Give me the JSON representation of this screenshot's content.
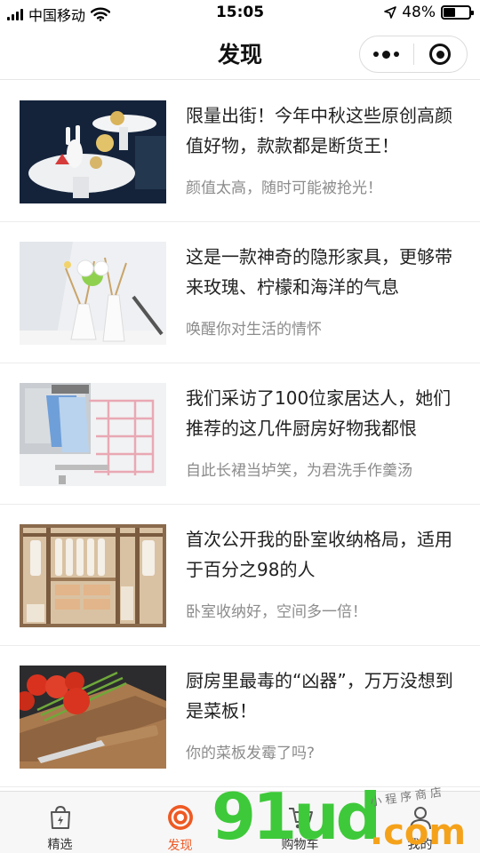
{
  "status_bar": {
    "carrier": "中国移动",
    "time": "15:05",
    "battery_text": "48%",
    "battery_level": 0.48
  },
  "nav": {
    "title": "发现"
  },
  "articles": [
    {
      "title": "限量出街！今年中秋这些原创高颜值好物，款款都是断货王！",
      "subtitle": "颜值太高，随时可能被抢光！"
    },
    {
      "title": "这是一款神奇的隐形家具，更够带来玫瑰、柠檬和海洋的气息",
      "subtitle": "唤醒你对生活的情怀"
    },
    {
      "title": "我们采访了100位家居达人，她们推荐的这几件厨房好物我都恨",
      "subtitle": "自此长裙当垆笑，为君洗手作羹汤"
    },
    {
      "title": "首次公开我的卧室收纳格局，适用于百分之98的人",
      "subtitle": "卧室收纳好，空间多一倍！"
    },
    {
      "title": "厨房里最毒的“凶器”，万万没想到是菜板！",
      "subtitle": "你的菜板发霉了吗?"
    }
  ],
  "tabs": [
    {
      "label": "精选",
      "icon": "bag-lightning-icon",
      "active": false
    },
    {
      "label": "发现",
      "icon": "target-icon",
      "active": true
    },
    {
      "label": "购物车",
      "icon": "cart-icon",
      "active": false
    },
    {
      "label": "我的",
      "icon": "user-icon",
      "active": false
    }
  ],
  "watermark": {
    "main": "91ud",
    "suffix": ".com",
    "tagline": "小程序商店"
  },
  "colors": {
    "accent": "#ee5a24",
    "watermark_green": "#3ec93a",
    "watermark_orange": "#f5a21b"
  }
}
